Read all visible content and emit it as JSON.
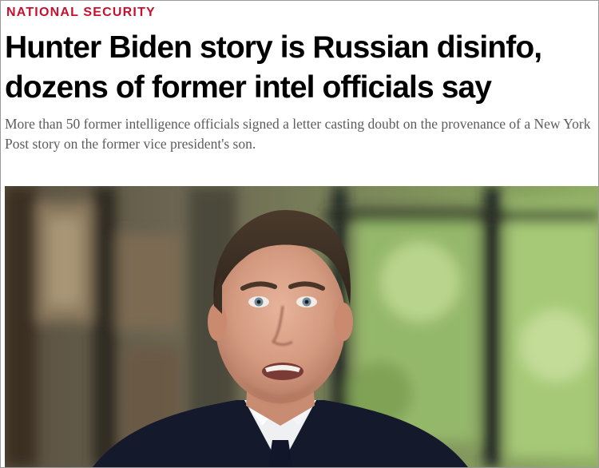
{
  "article": {
    "kicker": "NATIONAL SECURITY",
    "headline": "Hunter Biden story is Russian disinfo, dozens of former intel officials say",
    "dek": "More than 50 former intelligence officials signed a letter casting doubt on the provenance of a New York Post story on the former vice president's son."
  },
  "hero_image": {
    "subject": "man in dark suit and white shirt speaking in front of blurred window and greenery background"
  },
  "colors": {
    "kicker": "#c8102e",
    "headline": "#000000",
    "dek": "#5c5c5c"
  }
}
